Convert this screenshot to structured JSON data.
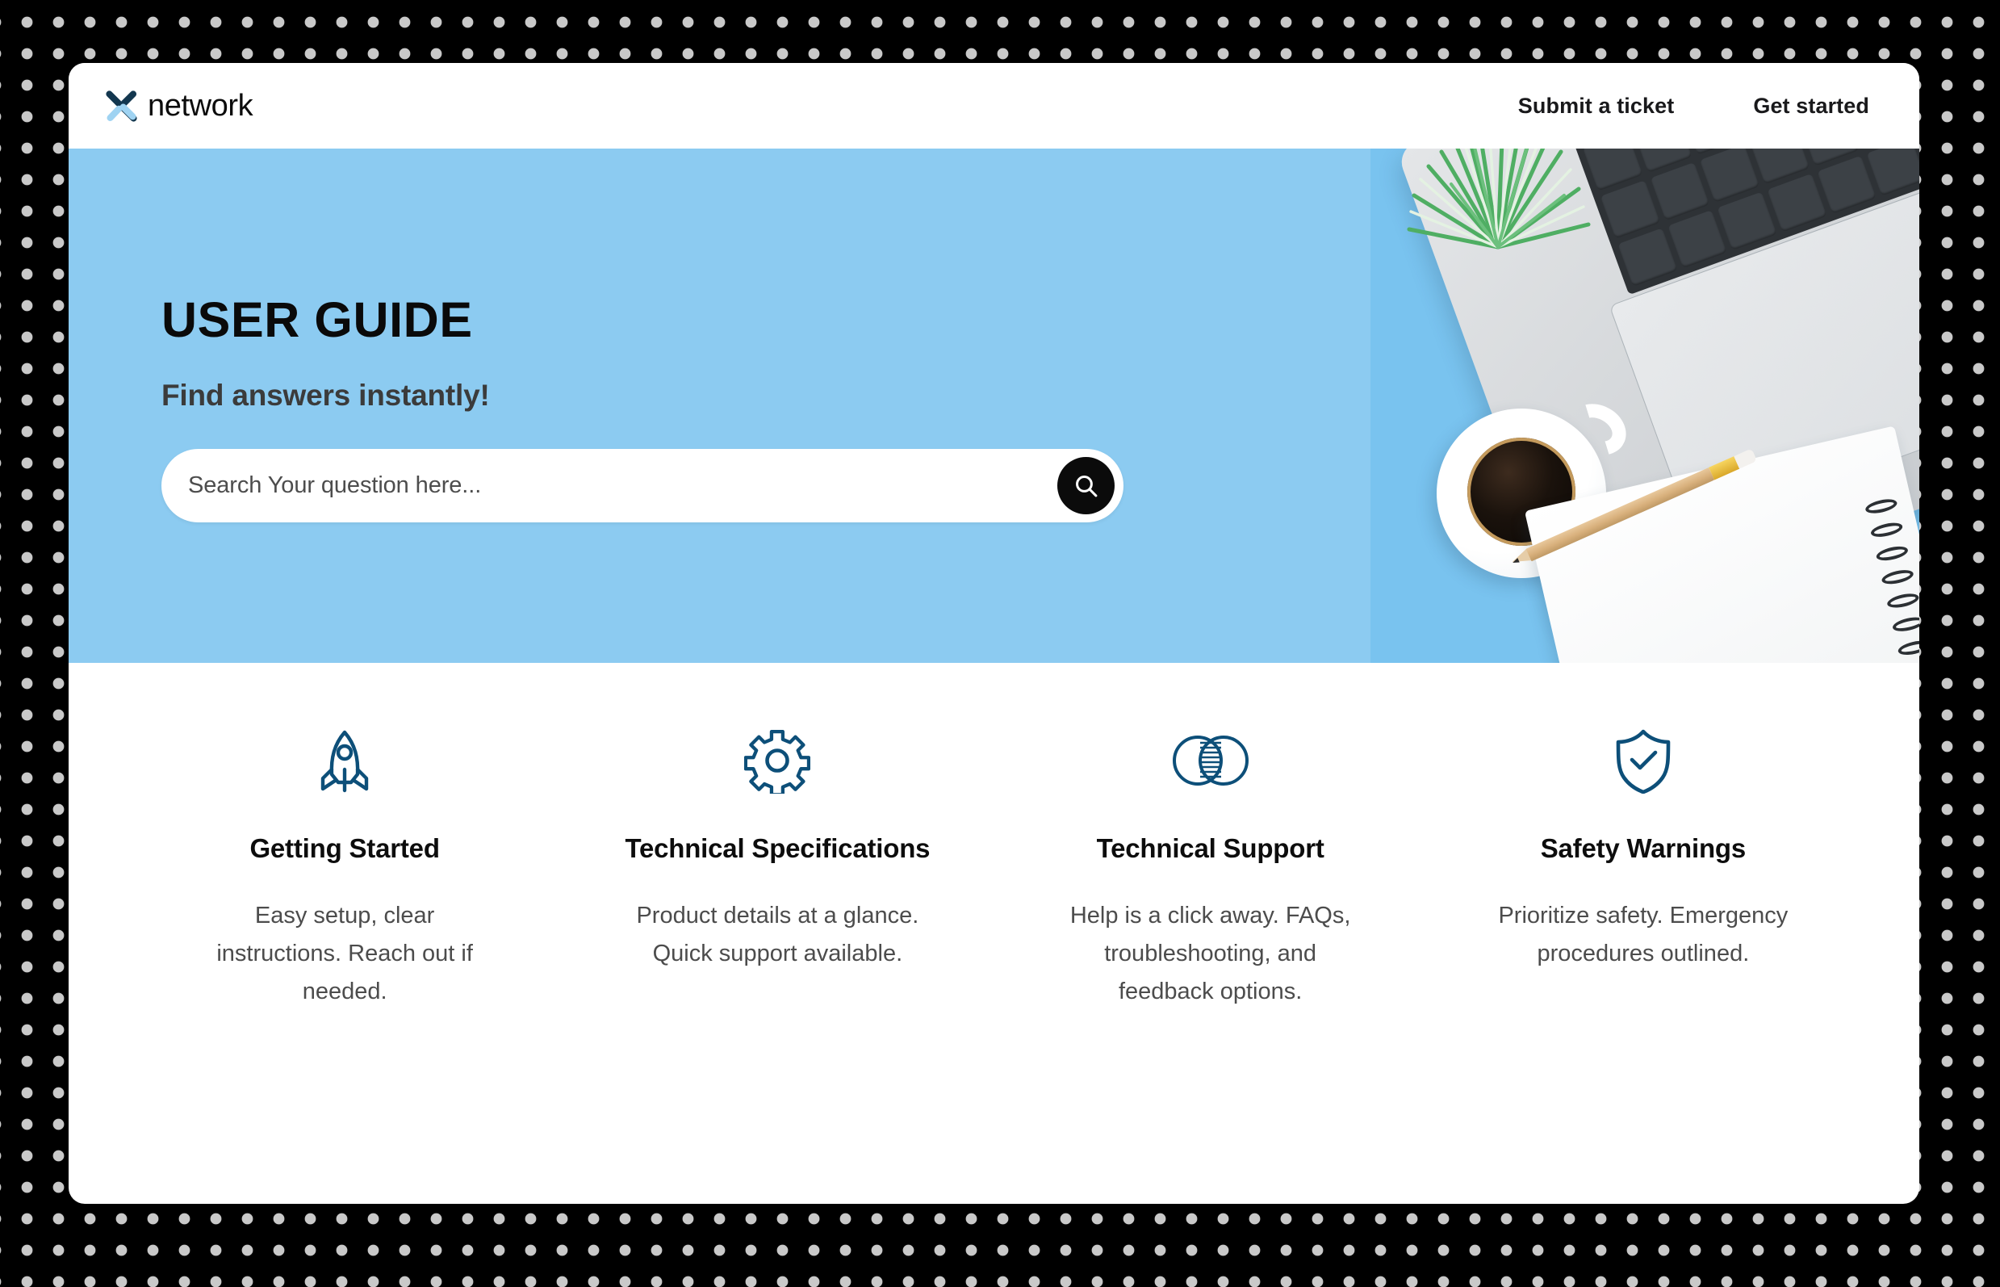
{
  "theme": {
    "hero_bg": "#8ccbf1",
    "icon_color": "#0d4f79",
    "page_bg": "#000000",
    "dot_color": "#c9c9c9",
    "card_bg": "#ffffff",
    "search_button_bg": "#0b0b0b"
  },
  "header": {
    "logo_icon": "x-network-logo-icon",
    "brand": "network",
    "nav": [
      {
        "label": "Submit a ticket",
        "name": "nav-link-submit-a-ticket"
      },
      {
        "label": "Get started",
        "name": "nav-link-get-started"
      }
    ]
  },
  "hero": {
    "title": "USER GUIDE",
    "subtitle": "Find answers instantly!",
    "search": {
      "value": "",
      "placeholder": "Search Your question here...",
      "button_icon": "search-icon"
    },
    "photo_alt": "flat-lay desk photo with laptop, plant, coffee cup, notebook and pencil on light blue background"
  },
  "features": [
    {
      "icon": "rocket-icon",
      "title": "Getting Started",
      "description": "Easy setup, clear instructions. Reach out if needed."
    },
    {
      "icon": "gear-icon",
      "title": "Technical Specifications",
      "description": "Product details at a glance. Quick support available."
    },
    {
      "icon": "overlapping-circles-icon",
      "title": "Technical Support",
      "description": "Help is a click away. FAQs, troubleshooting, and feedback options."
    },
    {
      "icon": "shield-check-icon",
      "title": "Safety Warnings",
      "description": "Prioritize safety. Emergency procedures outlined."
    }
  ]
}
